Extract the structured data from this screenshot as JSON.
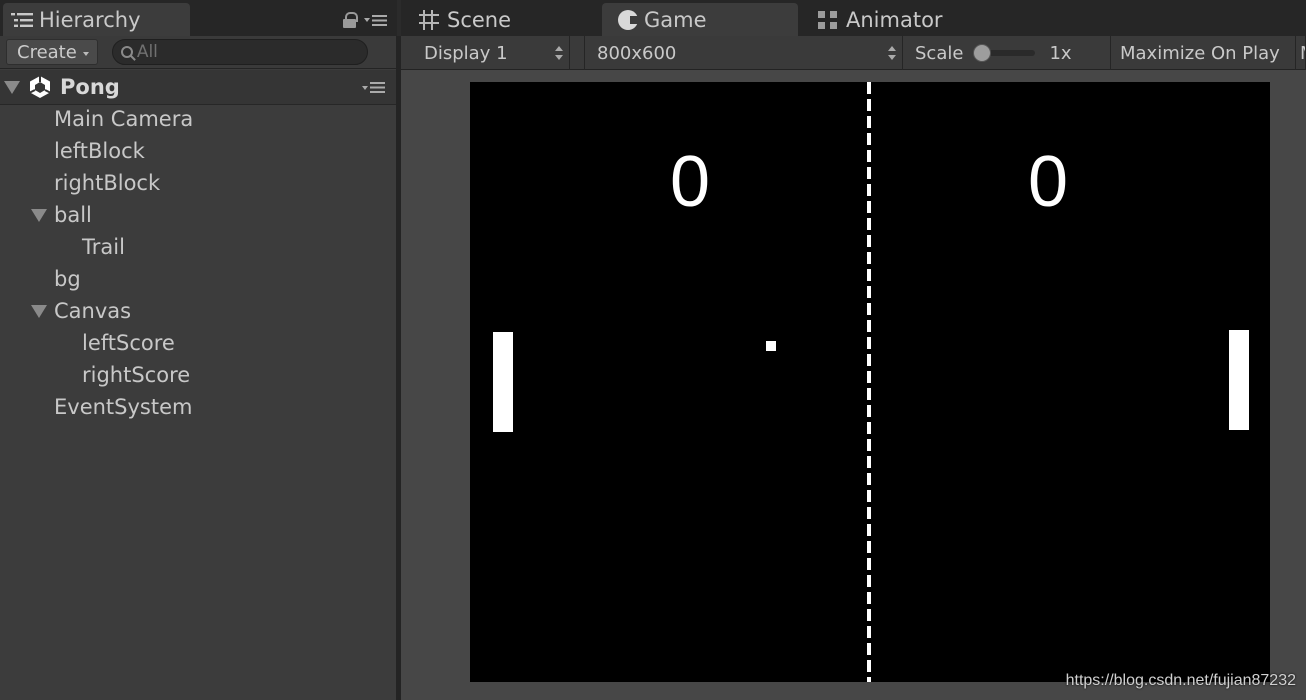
{
  "hierarchy": {
    "tab_label": "Hierarchy",
    "create_label": "Create",
    "search_placeholder": "All",
    "scene_name": "Pong",
    "items": [
      {
        "label": "Main Camera",
        "depth": 1,
        "expandable": false
      },
      {
        "label": "leftBlock",
        "depth": 1,
        "expandable": false
      },
      {
        "label": "rightBlock",
        "depth": 1,
        "expandable": false
      },
      {
        "label": "ball",
        "depth": 1,
        "expandable": true
      },
      {
        "label": "Trail",
        "depth": 2,
        "expandable": false
      },
      {
        "label": "bg",
        "depth": 1,
        "expandable": false
      },
      {
        "label": "Canvas",
        "depth": 1,
        "expandable": true
      },
      {
        "label": "leftScore",
        "depth": 2,
        "expandable": false
      },
      {
        "label": "rightScore",
        "depth": 2,
        "expandable": false
      },
      {
        "label": "EventSystem",
        "depth": 1,
        "expandable": false
      }
    ]
  },
  "tabs": {
    "scene": "Scene",
    "game": "Game",
    "animator": "Animator"
  },
  "game_toolbar": {
    "display": "Display 1",
    "resolution": "800x600",
    "scale_label": "Scale",
    "scale_value": "1x",
    "maximize": "Maximize On Play",
    "extra": "M"
  },
  "game": {
    "left_score": "0",
    "right_score": "0"
  },
  "watermark": "https://blog.csdn.net/fujian87232",
  "colors": {
    "panel_bg": "#3c3c3c",
    "tab_bar": "#262626",
    "game_bg": "#000000",
    "game_fg": "#ffffff"
  }
}
